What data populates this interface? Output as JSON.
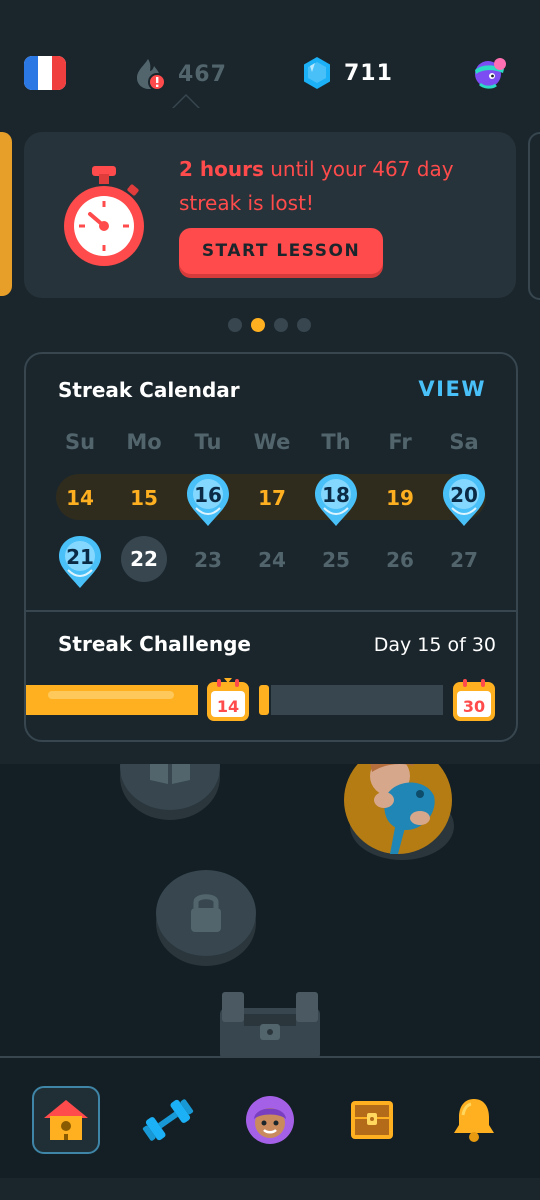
{
  "top_bar": {
    "flag_icon": "france-flag-icon",
    "streak_count": "467",
    "gem_count": "711",
    "profile_icon": "globe-character-icon"
  },
  "promo": {
    "hours_text": "2 hours",
    "rest_text": " until your 467 day streak is lost!",
    "button_label": "START LESSON",
    "carousel_dots": 4,
    "active_dot": 2
  },
  "calendar": {
    "title": "Streak Calendar",
    "view_label": "VIEW",
    "weekdays": [
      "Su",
      "Mo",
      "Tu",
      "We",
      "Th",
      "Fr",
      "Sa"
    ],
    "week1": [
      "14",
      "15",
      "16",
      "17",
      "18",
      "19",
      "20"
    ],
    "week2": [
      "21",
      "22",
      "23",
      "24",
      "25",
      "26",
      "27"
    ]
  },
  "challenge": {
    "title": "Streak Challenge",
    "progress_text": "Day 15 of 30",
    "milestone_start": "14",
    "milestone_end": "30",
    "progress_fraction": 0.5
  },
  "nav": {
    "items": [
      "home-icon",
      "practice-dumbbell-icon",
      "profile-avatar-icon",
      "treasure-chest-icon",
      "bell-icon"
    ]
  },
  "colors": {
    "background": "#131f24",
    "surface": "#1b262c",
    "accent_red": "#ff4b4b",
    "accent_gold": "#ffb020",
    "accent_blue": "#49c0f8"
  }
}
